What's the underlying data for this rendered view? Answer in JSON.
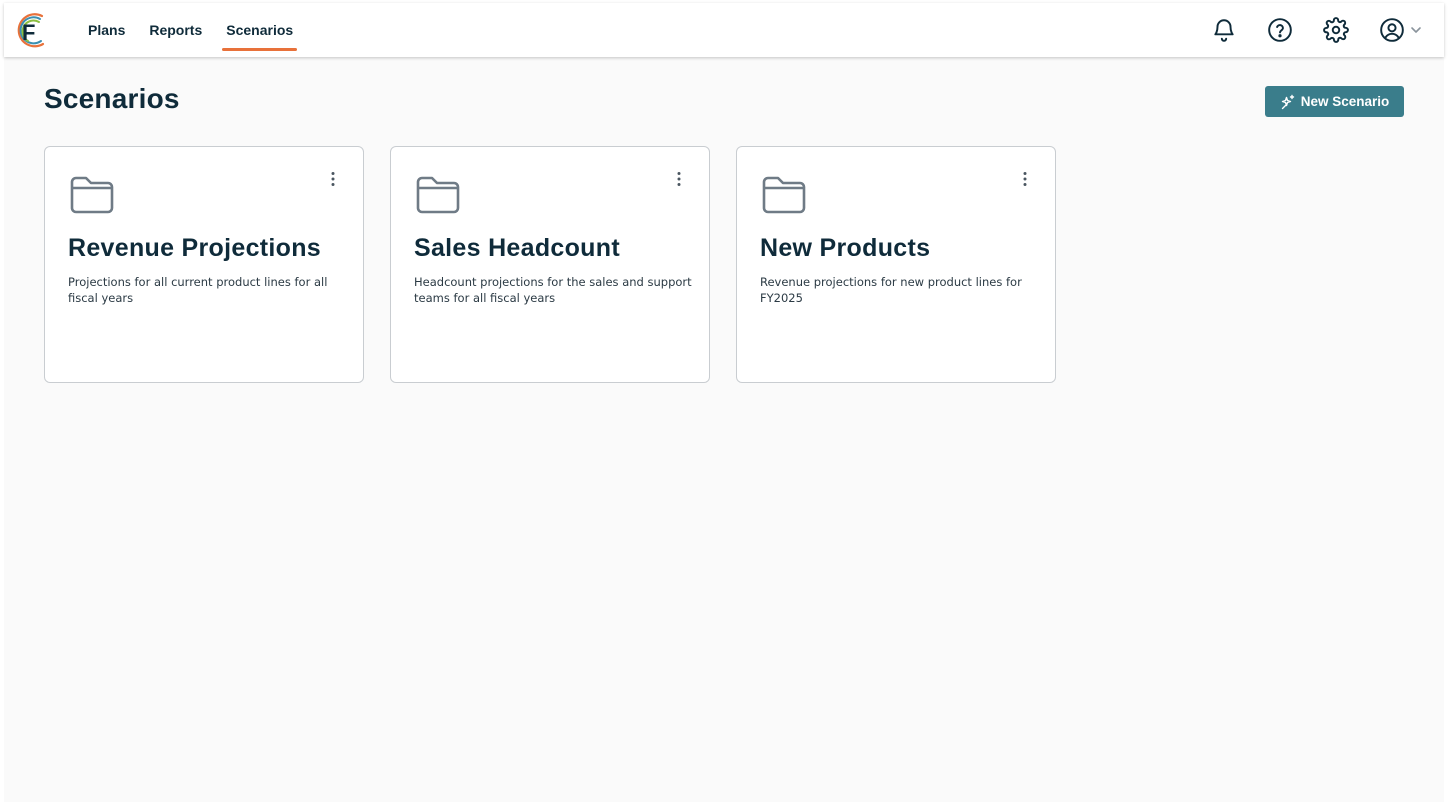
{
  "app": {
    "logo_letter": "F",
    "logo_name": "brand-logo"
  },
  "nav": {
    "tabs": [
      {
        "label": "Plans",
        "active": false
      },
      {
        "label": "Reports",
        "active": false
      },
      {
        "label": "Scenarios",
        "active": true
      }
    ]
  },
  "header_icons": [
    "bell-icon",
    "help-icon",
    "gear-icon",
    "user-circle-icon",
    "chevron-down-icon"
  ],
  "page": {
    "title": "Scenarios",
    "new_button_label": "New Scenario",
    "new_button_icon": "sparkle-icon"
  },
  "scenarios": [
    {
      "title": "Revenue Projections",
      "description": "Projections for all current product lines for all fiscal years",
      "icon": "folder-icon"
    },
    {
      "title": "Sales Headcount",
      "description": "Headcount projections for the sales and support teams for all fiscal years",
      "icon": "folder-icon"
    },
    {
      "title": "New Products",
      "description": "Revenue projections for new product lines for FY2025",
      "icon": "folder-icon"
    }
  ],
  "colors": {
    "accent": "#e8713a",
    "primary_button": "#3a7d8b",
    "text_dark": "#0f2b3a",
    "page_background": "#fafafa",
    "icon_gray": "#6f7b86"
  }
}
